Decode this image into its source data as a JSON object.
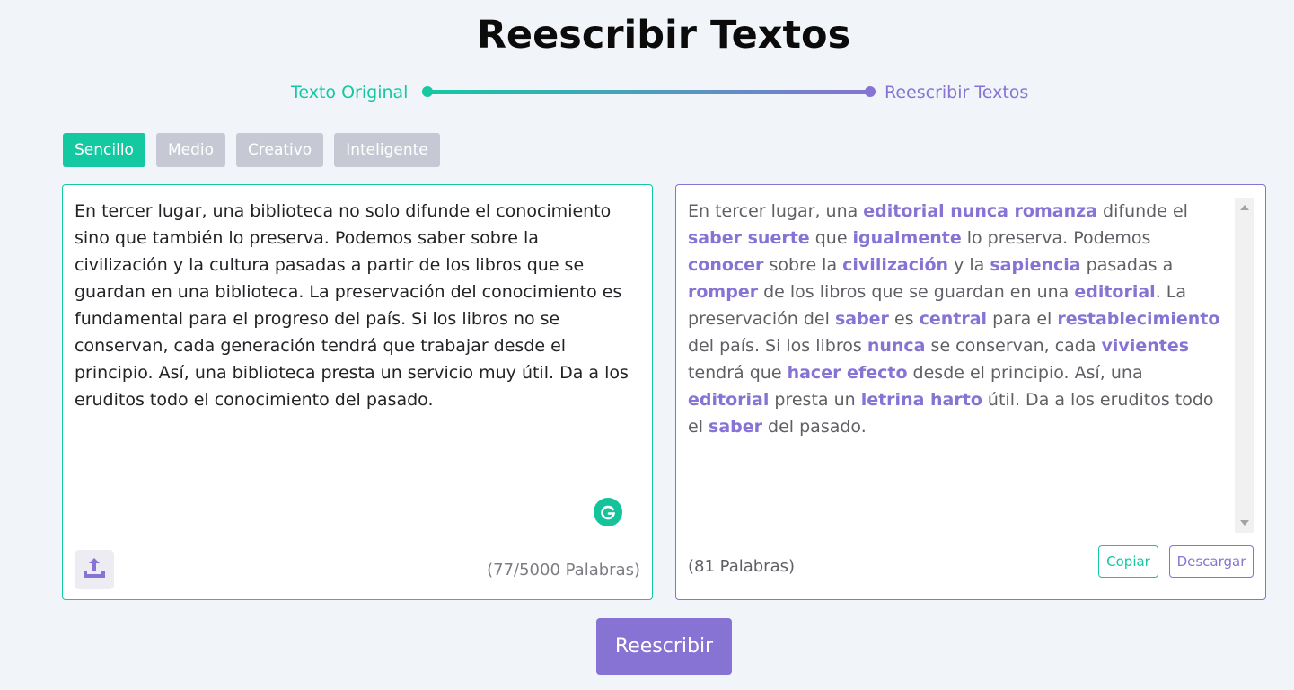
{
  "page": {
    "title": "Reescribir Textos"
  },
  "progress": {
    "step_left": "Texto Original",
    "step_right": "Reescribir Textos"
  },
  "modes": [
    {
      "label": "Sencillo",
      "active": true
    },
    {
      "label": "Medio",
      "active": false
    },
    {
      "label": "Creativo",
      "active": false
    },
    {
      "label": "Inteligente",
      "active": false
    }
  ],
  "input": {
    "text": "En tercer lugar, una biblioteca no solo difunde el conocimiento sino que también lo preserva. Podemos saber sobre la civilización y la cultura pasadas a partir de los libros que se guardan en una biblioteca. La preservación del conocimiento es fundamental para el progreso del país. Si los libros no se conservan, cada generación tendrá que trabajar desde el principio. Así, una biblioteca presta un servicio muy útil. Da a los eruditos todo el conocimiento del pasado.",
    "word_count": "(77/5000 Palabras)"
  },
  "output": {
    "segments": [
      {
        "text": "En tercer lugar, una ",
        "changed": false
      },
      {
        "text": "editorial nunca romanza",
        "changed": true
      },
      {
        "text": " difunde el ",
        "changed": false
      },
      {
        "text": "saber suerte",
        "changed": true
      },
      {
        "text": " que ",
        "changed": false
      },
      {
        "text": "igualmente",
        "changed": true
      },
      {
        "text": " lo preserva. Podemos ",
        "changed": false
      },
      {
        "text": "conocer",
        "changed": true
      },
      {
        "text": " sobre la ",
        "changed": false
      },
      {
        "text": "civilización",
        "changed": true
      },
      {
        "text": " y la ",
        "changed": false
      },
      {
        "text": "sapiencia",
        "changed": true
      },
      {
        "text": " pasadas a ",
        "changed": false
      },
      {
        "text": "romper",
        "changed": true
      },
      {
        "text": " de los libros que se guardan en una ",
        "changed": false
      },
      {
        "text": "editorial",
        "changed": true
      },
      {
        "text": ". La preservación del ",
        "changed": false
      },
      {
        "text": "saber",
        "changed": true
      },
      {
        "text": " es ",
        "changed": false
      },
      {
        "text": "central",
        "changed": true
      },
      {
        "text": " para el ",
        "changed": false
      },
      {
        "text": "restablecimiento",
        "changed": true
      },
      {
        "text": " del país. Si los libros ",
        "changed": false
      },
      {
        "text": "nunca",
        "changed": true
      },
      {
        "text": " se conservan, cada ",
        "changed": false
      },
      {
        "text": "vivientes",
        "changed": true
      },
      {
        "text": " tendrá que ",
        "changed": false
      },
      {
        "text": "hacer efecto",
        "changed": true
      },
      {
        "text": " desde el principio. Así, una ",
        "changed": false
      },
      {
        "text": "editorial",
        "changed": true
      },
      {
        "text": " presta un ",
        "changed": false
      },
      {
        "text": "letrina harto",
        "changed": true
      },
      {
        "text": " útil. Da a los eruditos todo el ",
        "changed": false
      },
      {
        "text": "saber",
        "changed": true
      },
      {
        "text": " del pasado.",
        "changed": false
      }
    ],
    "word_count": "(81 Palabras)",
    "copy_label": "Copiar",
    "download_label": "Descargar"
  },
  "actions": {
    "rewrite_label": "Reescribir"
  },
  "icons": {
    "upload": "upload-icon",
    "grammarly": "grammarly-icon"
  },
  "colors": {
    "accent_green": "#14c8a2",
    "accent_purple": "#8673d4",
    "inactive_mode": "#c6c9d4",
    "background": "#f1f4f8"
  }
}
